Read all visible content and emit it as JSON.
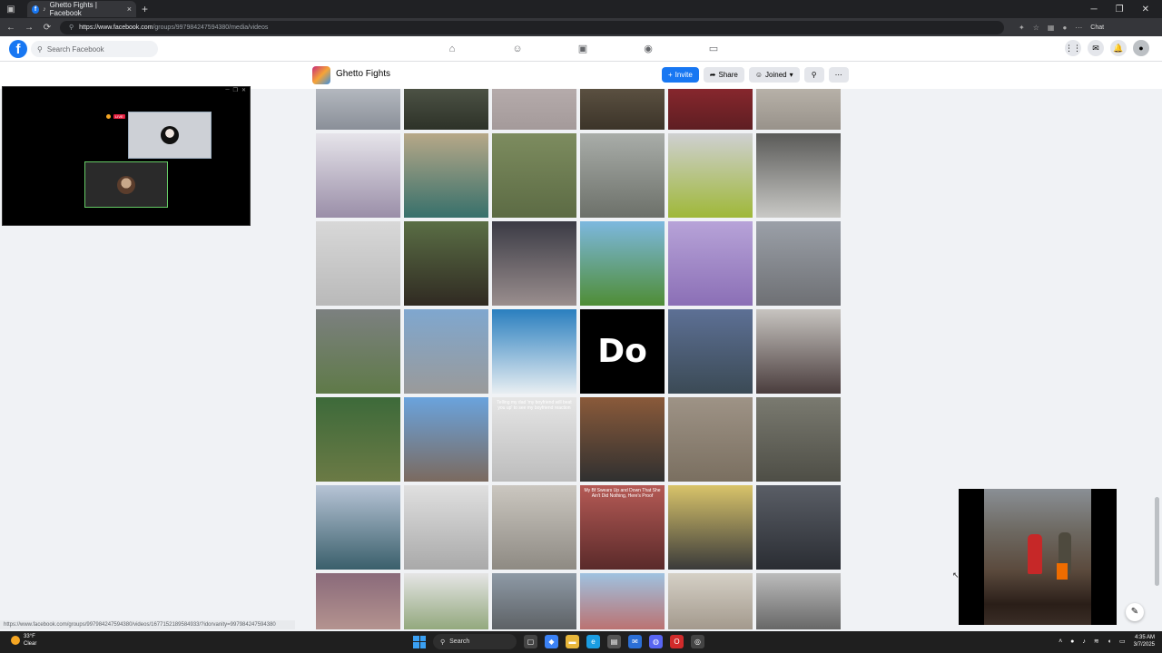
{
  "browser": {
    "tab_title": "Ghetto Fights | Facebook",
    "tab_close": "×",
    "new_tab": "+",
    "url_host": "https://www.facebook.com",
    "url_path": "/groups/997984247594380/media/videos",
    "chat_label": "Chat",
    "status_url": "https://www.facebook.com/groups/997984247594380/videos/1677152189584933/?idorvanity=997984247594380"
  },
  "facebook": {
    "logo": "f",
    "search_placeholder": "Search Facebook"
  },
  "group": {
    "name": "Ghetto Fights",
    "buttons": {
      "invite": "Invite",
      "share": "Share",
      "joined": "Joined"
    }
  },
  "live_panel": {
    "badge": "LIVE"
  },
  "tiles": [
    {
      "bg": "linear-gradient(180deg,#dfe3e8,#8a8f98)"
    },
    {
      "bg": "linear-gradient(180deg,#6d7363,#2d3228)"
    },
    {
      "bg": "linear-gradient(180deg,#c7bdbd,#a49a9a)"
    },
    {
      "bg": "linear-gradient(180deg,#7b6e5a,#3c3429)"
    },
    {
      "bg": "linear-gradient(180deg,#b23039,#5e1e22)"
    },
    {
      "bg": "linear-gradient(180deg,#d8d2c8,#98928a)"
    },
    {
      "bg": "linear-gradient(180deg,#e6e4ea,#9a8ea8)"
    },
    {
      "bg": "linear-gradient(180deg,#b7a888,#37706b)"
    },
    {
      "bg": "linear-gradient(180deg,#7d8c5f,#5c6b44)"
    },
    {
      "bg": "linear-gradient(180deg,#a9ada9,#6c7069)"
    },
    {
      "bg": "linear-gradient(180deg,#cfd0d2,#9fb838)"
    },
    {
      "bg": "linear-gradient(180deg,#5a5a58,#c9c9c6)"
    },
    {
      "bg": "linear-gradient(180deg,#d8d8d8,#b9b9b9)"
    },
    {
      "bg": "linear-gradient(180deg,#5a6e45,#302a22)"
    },
    {
      "bg": "linear-gradient(180deg,#3b3b45,#9a8e8e)"
    },
    {
      "bg": "linear-gradient(180deg,#7db8df,#4f8d35)"
    },
    {
      "bg": "linear-gradient(180deg,#b7a3d8,#8b6fb6)"
    },
    {
      "bg": "linear-gradient(180deg,#9ba0a8,#6e7074)"
    },
    {
      "bg": "linear-gradient(180deg,#7c8080,#5f7a48)"
    },
    {
      "bg": "linear-gradient(180deg,#7fa7cf,#9a9a9a)"
    },
    {
      "bg": "linear-gradient(180deg,#2a7fbf,#e8eef2)"
    },
    {
      "bg": "#000000",
      "big": "Do"
    },
    {
      "bg": "linear-gradient(180deg,#5d7095,#3b4a55)"
    },
    {
      "bg": "linear-gradient(180deg,#c7c4c0,#4a3d3d)"
    },
    {
      "bg": "linear-gradient(180deg,#3d6a3a,#6b7a45)"
    },
    {
      "bg": "linear-gradient(180deg,#6aa3dd,#7b6a5f)"
    },
    {
      "bg": "linear-gradient(180deg,#e6e6e6,#bcbcbc)",
      "cap": "Telling my dad 'my boyfriend will beat you up' to see my boyfriend reaction"
    },
    {
      "bg": "linear-gradient(180deg,#8a5a3a,#303030)"
    },
    {
      "bg": "linear-gradient(180deg,#9e9386,#7a6f60)"
    },
    {
      "bg": "linear-gradient(180deg,#7a7a70,#4e4e46)"
    },
    {
      "bg": "linear-gradient(180deg,#b7c4d6,#3a5f6b)"
    },
    {
      "bg": "linear-gradient(180deg,#e0e0e0,#a9a9a9)"
    },
    {
      "bg": "linear-gradient(180deg,#cbc7c0,#8e8a83)"
    },
    {
      "bg": "linear-gradient(180deg,#b55a55,#5a2a2a)",
      "cap": "My Bf Swears Up and Down That She Ain't Did Nothing, Here's Proof"
    },
    {
      "bg": "linear-gradient(180deg,#d9c46a,#3a3a3a)"
    },
    {
      "bg": "linear-gradient(180deg,#5a5e66,#2a2d33)"
    },
    {
      "bg": "linear-gradient(180deg,#8a6a7a,#c9a89a)"
    },
    {
      "bg": "linear-gradient(180deg,#e5e5e5,#6a8a4a)"
    },
    {
      "bg": "linear-gradient(180deg,#8e9aa6,#454545)"
    },
    {
      "bg": "linear-gradient(180deg,#9fc2e0,#c94a3a)"
    },
    {
      "bg": "linear-gradient(180deg,#d5d0c6,#8a7e70)"
    },
    {
      "bg": "linear-gradient(180deg,#bcbcbc,#3d3d3d)"
    }
  ],
  "taskbar": {
    "weather_temp": "33°F",
    "weather_desc": "Clear",
    "search_label": "Search",
    "time": "4:35 AM",
    "date": "3/7/2025"
  }
}
